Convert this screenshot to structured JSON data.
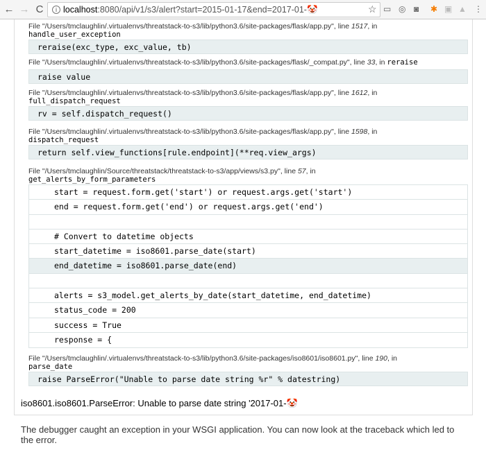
{
  "browser": {
    "url_host": "localhost",
    "url_rest": ":8080/api/v1/s3/alert?start=2015-01-17&end=2017-01-🤡",
    "back": "←",
    "forward": "→",
    "reload": "C"
  },
  "frames": [
    {
      "file_pre": "File \"/Users/tmclaughlin/.virtualenvs/threatstack-to-s3/lib/python3.6/site-packages/flask/app.py\", line ",
      "line": "1517",
      "file_post": ", in",
      "func": "handle_user_exception",
      "code": "reraise(exc_type, exc_value, tb)"
    },
    {
      "file_pre": "File \"/Users/tmclaughlin/.virtualenvs/threatstack-to-s3/lib/python3.6/site-packages/flask/_compat.py\", line ",
      "line": "33",
      "file_post": ", in",
      "func": "reraise",
      "code": "raise value"
    },
    {
      "file_pre": "File \"/Users/tmclaughlin/.virtualenvs/threatstack-to-s3/lib/python3.6/site-packages/flask/app.py\", line ",
      "line": "1612",
      "file_post": ", in",
      "func": "full_dispatch_request",
      "code": "rv = self.dispatch_request()"
    },
    {
      "file_pre": "File \"/Users/tmclaughlin/.virtualenvs/threatstack-to-s3/lib/python3.6/site-packages/flask/app.py\", line ",
      "line": "1598",
      "file_post": ", in",
      "func": "dispatch_request",
      "code": "return self.view_functions[rule.endpoint](**req.view_args)"
    },
    {
      "file_pre": "File \"/Users/tmclaughlin/Source/threatstack/threatstack-to-s3/app/views/s3.py\", line ",
      "line": "57",
      "file_post": ", in",
      "func": "get_alerts_by_form_parameters",
      "lines": [
        "start = request.form.get('start') or request.args.get('start')",
        "end = request.form.get('end') or request.args.get('end')",
        "",
        "# Convert to datetime objects",
        "start_datetime = iso8601.parse_date(start)",
        "end_datetime = iso8601.parse_date(end)",
        "",
        "alerts = s3_model.get_alerts_by_date(start_datetime, end_datetime)",
        "status_code = 200",
        "success = True",
        "response = {"
      ]
    },
    {
      "file_pre": "File \"/Users/tmclaughlin/.virtualenvs/threatstack-to-s3/lib/python3.6/site-packages/iso8601/iso8601.py\", line ",
      "line": "190",
      "file_post": ", in",
      "func": "parse_date",
      "code": "raise ParseError(\"Unable to parse date string %r\" % datestring)"
    }
  ],
  "exception": "iso8601.iso8601.ParseError: Unable to parse date string '2017-01-🤡",
  "footer": "The debugger caught an exception in your WSGI application. You can now look at the traceback which led to the error."
}
